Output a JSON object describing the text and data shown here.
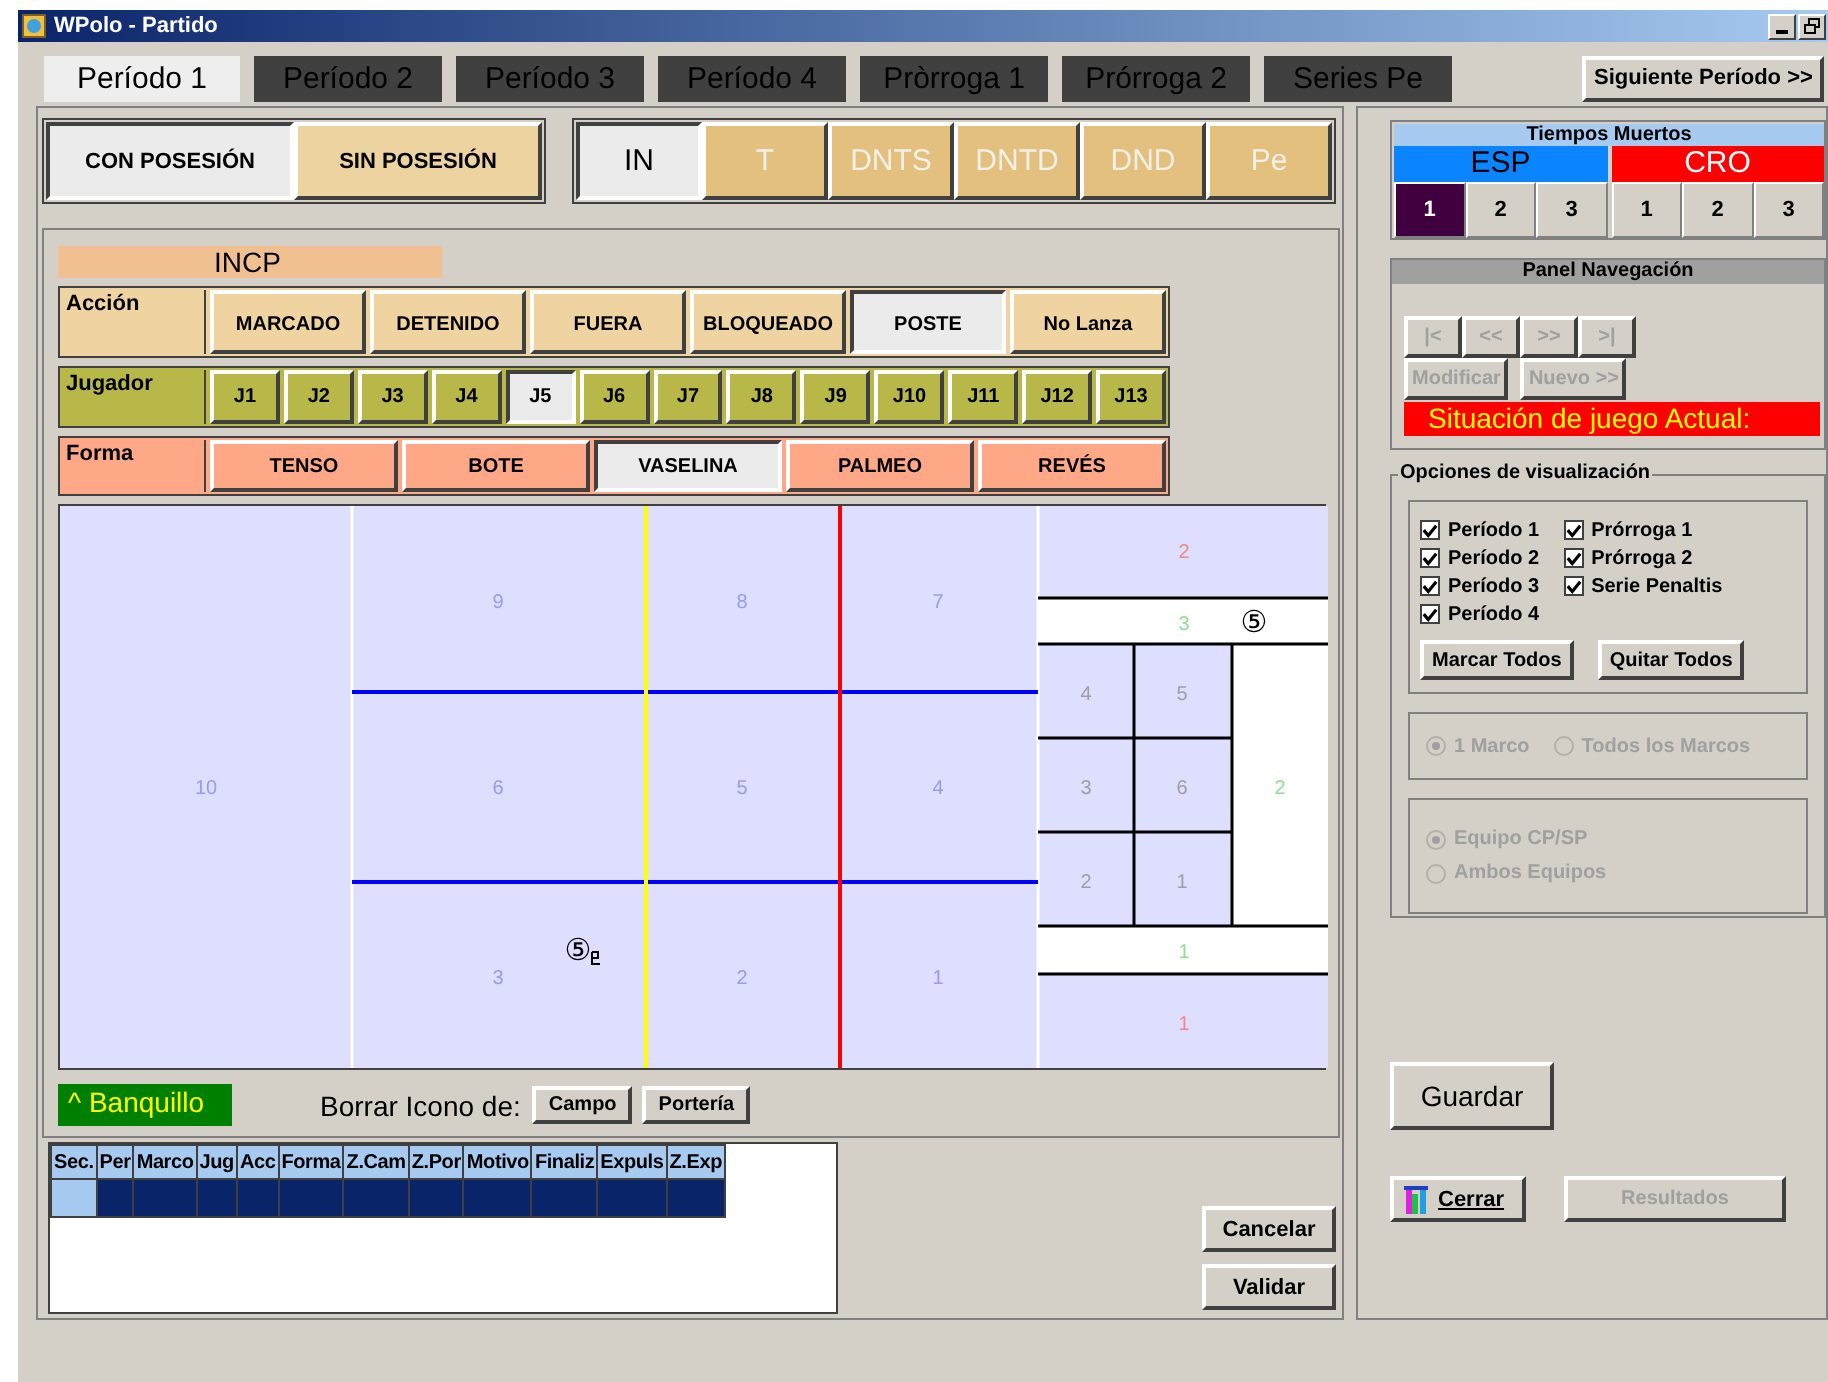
{
  "window": {
    "title": "WPolo - Partido"
  },
  "period_tabs": [
    {
      "label": "Período 1",
      "selected": true
    },
    {
      "label": "Período 2",
      "selected": false
    },
    {
      "label": "Período 3",
      "selected": false
    },
    {
      "label": "Período 4",
      "selected": false
    },
    {
      "label": "Pròrroga 1",
      "selected": false
    },
    {
      "label": "Prórroga 2",
      "selected": false
    },
    {
      "label": "Series Pe",
      "selected": false
    }
  ],
  "next_period_button": "Siguiente Período >>",
  "possession": [
    {
      "label": "CON POSESIÓN",
      "selected": true
    },
    {
      "label": "SIN POSESIÓN",
      "selected": false
    }
  ],
  "situations": [
    {
      "label": "IN",
      "selected": true,
      "disabled": false
    },
    {
      "label": "T",
      "selected": false,
      "disabled": true
    },
    {
      "label": "DNTS",
      "selected": false,
      "disabled": true
    },
    {
      "label": "DNTD",
      "selected": false,
      "disabled": true
    },
    {
      "label": "DND",
      "selected": false,
      "disabled": true
    },
    {
      "label": "Pe",
      "selected": false,
      "disabled": true
    }
  ],
  "play_label": "INCP",
  "choice_rows": [
    {
      "kind": "action",
      "label": "Acción",
      "options": [
        {
          "label": "MARCADO",
          "selected": false
        },
        {
          "label": "DETENIDO",
          "selected": false
        },
        {
          "label": "FUERA",
          "selected": false
        },
        {
          "label": "BLOQUEADO",
          "selected": false
        },
        {
          "label": "POSTE",
          "selected": true
        },
        {
          "label": "No Lanza",
          "selected": false
        }
      ]
    },
    {
      "kind": "player",
      "label": "Jugador",
      "options": [
        {
          "label": "J1",
          "selected": false
        },
        {
          "label": "J2",
          "selected": false
        },
        {
          "label": "J3",
          "selected": false
        },
        {
          "label": "J4",
          "selected": false
        },
        {
          "label": "J5",
          "selected": true
        },
        {
          "label": "J6",
          "selected": false
        },
        {
          "label": "J7",
          "selected": false
        },
        {
          "label": "J8",
          "selected": false
        },
        {
          "label": "J9",
          "selected": false
        },
        {
          "label": "J10",
          "selected": false
        },
        {
          "label": "J11",
          "selected": false
        },
        {
          "label": "J12",
          "selected": false
        },
        {
          "label": "J13",
          "selected": false
        }
      ]
    },
    {
      "kind": "shape",
      "label": "Forma",
      "options": [
        {
          "label": "TENSO",
          "selected": false
        },
        {
          "label": "BOTE",
          "selected": false
        },
        {
          "label": "VASELINA",
          "selected": true
        },
        {
          "label": "PALMEO",
          "selected": false
        },
        {
          "label": "REVÉS",
          "selected": false
        }
      ]
    }
  ],
  "court": {
    "zones": [
      {
        "label": "9"
      },
      {
        "label": "8"
      },
      {
        "label": "7"
      },
      {
        "label": "10"
      },
      {
        "label": "6"
      },
      {
        "label": "5"
      },
      {
        "label": "4"
      },
      {
        "label": "3"
      },
      {
        "label": "2"
      },
      {
        "label": "1"
      }
    ],
    "goal_zones": [
      {
        "label": "2",
        "color": "#f08888"
      },
      {
        "label": "3",
        "color": "#90e090"
      },
      {
        "label": "4",
        "color": "#a0a0a0"
      },
      {
        "label": "5",
        "color": "#a0a0a0"
      },
      {
        "label": "3",
        "color": "#a0a0a0"
      },
      {
        "label": "6",
        "color": "#a0a0a0"
      },
      {
        "label": "2",
        "color": "#a0a0a0"
      },
      {
        "label": "1",
        "color": "#a0a0a0"
      },
      {
        "label": "2",
        "color": "#90e090"
      },
      {
        "label": "1",
        "color": "#90e090"
      },
      {
        "label": "1",
        "color": "#f08888"
      }
    ],
    "markers": [
      {
        "label": "⑤"
      },
      {
        "label": "⑤"
      }
    ]
  },
  "bench_label": "^ Banquillo",
  "erase_label": "Borrar Icono de:",
  "erase_buttons": [
    "Campo",
    "Portería"
  ],
  "table": {
    "columns": [
      "Sec.",
      "Per",
      "Marco",
      "Jug",
      "Acc",
      "Forma",
      "Z.Cam",
      "Z.Por",
      "Motivo",
      "Finaliz",
      "Expuls",
      "Z.Exp"
    ],
    "rows": [
      {
        "selected": true
      }
    ]
  },
  "form_buttons": [
    "Cancelar",
    "Validar"
  ],
  "timeouts": {
    "title": "Tiempos Muertos",
    "teams": [
      {
        "name": "ESP",
        "color": "#0a84ff",
        "slots": [
          {
            "label": "1",
            "used": true
          },
          {
            "label": "2",
            "used": false
          },
          {
            "label": "3",
            "used": false
          }
        ]
      },
      {
        "name": "CRO",
        "color": "#ff0000",
        "slots": [
          {
            "label": "1",
            "used": false
          },
          {
            "label": "2",
            "used": false
          },
          {
            "label": "3",
            "used": false
          }
        ]
      }
    ]
  },
  "navigation": {
    "title": "Panel Navegación",
    "nav_buttons": [
      {
        "label": "|<",
        "disabled": true
      },
      {
        "label": "<<",
        "disabled": true
      },
      {
        "label": ">>",
        "disabled": true
      },
      {
        "label": ">|",
        "disabled": true
      }
    ],
    "action_buttons": [
      {
        "label": "Modificar",
        "disabled": true
      },
      {
        "label": "Nuevo >>",
        "disabled": true
      }
    ],
    "status": "Situación de juego Actual:"
  },
  "display_options": {
    "title": "Opciones de visualización",
    "columns": [
      [
        {
          "label": "Período 1",
          "checked": true
        },
        {
          "label": "Período 2",
          "checked": true
        },
        {
          "label": "Período 3",
          "checked": true
        },
        {
          "label": "Período 4",
          "checked": true
        }
      ],
      [
        {
          "label": "Prórroga 1",
          "checked": true
        },
        {
          "label": "Prórroga 2",
          "checked": true
        },
        {
          "label": "Serie Penaltis",
          "checked": true
        }
      ]
    ],
    "buttons": [
      "Marcar Todos",
      "Quitar Todos"
    ],
    "frame_radios": [
      {
        "label": "1 Marco",
        "selected": true,
        "disabled": true
      },
      {
        "label": "Todos los Marcos",
        "selected": false,
        "disabled": true
      }
    ],
    "team_radios": [
      {
        "label": "Equipo CP/SP",
        "selected": true,
        "disabled": true
      },
      {
        "label": "Ambos Equipos",
        "selected": false,
        "disabled": true
      }
    ]
  },
  "save_button": "Guardar",
  "close_button": "Cerrar",
  "results_button": {
    "label": "Resultados",
    "disabled": true
  }
}
